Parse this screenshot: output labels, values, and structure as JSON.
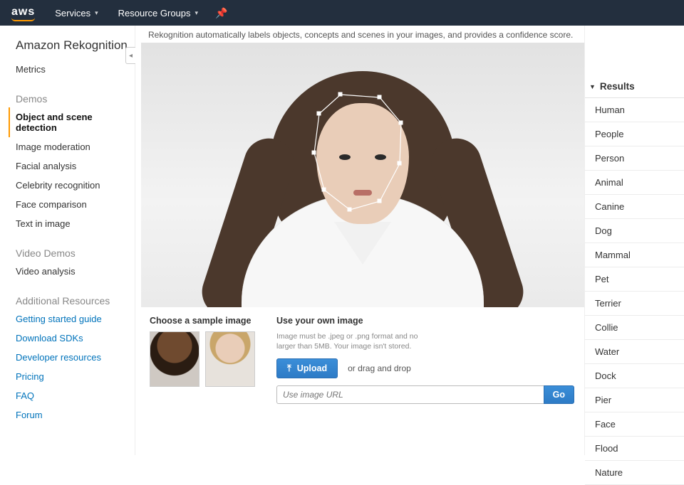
{
  "topnav": {
    "logo": "aws",
    "items": [
      "Services",
      "Resource Groups"
    ]
  },
  "sidebar": {
    "service_title": "Amazon Rekognition",
    "metrics": "Metrics",
    "demos_heading": "Demos",
    "demo_items": [
      "Object and scene detection",
      "Image moderation",
      "Facial analysis",
      "Celebrity recognition",
      "Face comparison",
      "Text in image"
    ],
    "video_heading": "Video Demos",
    "video_items": [
      "Video analysis"
    ],
    "additional_heading": "Additional Resources",
    "additional_items": [
      "Getting started guide",
      "Download SDKs",
      "Developer resources",
      "Pricing",
      "FAQ",
      "Forum"
    ]
  },
  "content": {
    "description": "Rekognition automatically labels objects, concepts and scenes in your images, and provides a confidence score.",
    "sample_heading": "Choose a sample image",
    "own_heading": "Use your own image",
    "own_hint": "Image must be .jpeg or .png format and no larger than 5MB. Your image isn't stored.",
    "upload_label": "Upload",
    "drag_text": "or drag and drop",
    "url_placeholder": "Use image URL",
    "go_label": "Go"
  },
  "results": {
    "heading": "Results",
    "items": [
      "Human",
      "People",
      "Person",
      "Animal",
      "Canine",
      "Dog",
      "Mammal",
      "Pet",
      "Terrier",
      "Collie",
      "Water",
      "Dock",
      "Pier",
      "Face",
      "Flood",
      "Nature"
    ]
  }
}
